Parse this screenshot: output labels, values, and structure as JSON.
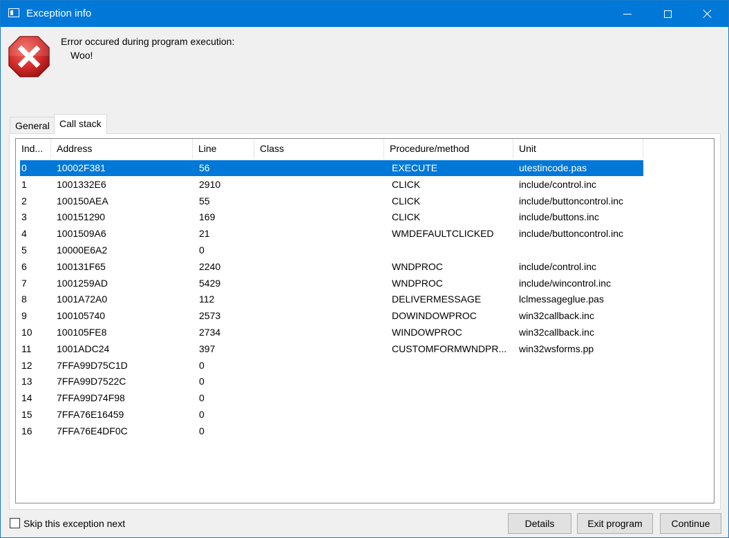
{
  "window": {
    "title": "Exception info"
  },
  "message": {
    "line1": "Error occured during program execution:",
    "line2": "Woo!"
  },
  "tabs": [
    {
      "label": "General",
      "active": false
    },
    {
      "label": "Call stack",
      "active": true
    }
  ],
  "columns": [
    "Ind...",
    "Address",
    "Line",
    "Class",
    "Procedure/method",
    "Unit"
  ],
  "rows": [
    {
      "index": "0",
      "address": "10002F381",
      "line": "56",
      "class": "",
      "procedure": "EXECUTE",
      "unit": "utestincode.pas",
      "selected": true
    },
    {
      "index": "1",
      "address": "1001332E6",
      "line": "2910",
      "class": "",
      "procedure": "CLICK",
      "unit": "include/control.inc"
    },
    {
      "index": "2",
      "address": "100150AEA",
      "line": "55",
      "class": "",
      "procedure": "CLICK",
      "unit": "include/buttoncontrol.inc"
    },
    {
      "index": "3",
      "address": "100151290",
      "line": "169",
      "class": "",
      "procedure": "CLICK",
      "unit": "include/buttons.inc"
    },
    {
      "index": "4",
      "address": "1001509A6",
      "line": "21",
      "class": "",
      "procedure": "WMDEFAULTCLICKED",
      "unit": "include/buttoncontrol.inc"
    },
    {
      "index": "5",
      "address": "10000E6A2",
      "line": "0",
      "class": "",
      "procedure": "",
      "unit": ""
    },
    {
      "index": "6",
      "address": "100131F65",
      "line": "2240",
      "class": "",
      "procedure": "WNDPROC",
      "unit": "include/control.inc"
    },
    {
      "index": "7",
      "address": "1001259AD",
      "line": "5429",
      "class": "",
      "procedure": "WNDPROC",
      "unit": "include/wincontrol.inc"
    },
    {
      "index": "8",
      "address": "1001A72A0",
      "line": "112",
      "class": "",
      "procedure": "DELIVERMESSAGE",
      "unit": "lclmessageglue.pas"
    },
    {
      "index": "9",
      "address": "100105740",
      "line": "2573",
      "class": "",
      "procedure": "DOWINDOWPROC",
      "unit": "win32callback.inc"
    },
    {
      "index": "10",
      "address": "100105FE8",
      "line": "2734",
      "class": "",
      "procedure": "WINDOWPROC",
      "unit": "win32callback.inc"
    },
    {
      "index": "11",
      "address": "1001ADC24",
      "line": "397",
      "class": "",
      "procedure": "CUSTOMFORMWNDPR...",
      "unit": "win32wsforms.pp"
    },
    {
      "index": "12",
      "address": "7FFA99D75C1D",
      "line": "0",
      "class": "",
      "procedure": "",
      "unit": ""
    },
    {
      "index": "13",
      "address": "7FFA99D7522C",
      "line": "0",
      "class": "",
      "procedure": "",
      "unit": ""
    },
    {
      "index": "14",
      "address": "7FFA99D74F98",
      "line": "0",
      "class": "",
      "procedure": "",
      "unit": ""
    },
    {
      "index": "15",
      "address": "7FFA76E16459",
      "line": "0",
      "class": "",
      "procedure": "",
      "unit": ""
    },
    {
      "index": "16",
      "address": "7FFA76E4DF0C",
      "line": "0",
      "class": "",
      "procedure": "",
      "unit": ""
    }
  ],
  "footer": {
    "skip_label": "Skip this exception next",
    "skip_checked": false,
    "details_label": "Details",
    "exit_label": "Exit program",
    "continue_label": "Continue"
  },
  "colors": {
    "titlebar": "#0078d7",
    "selection": "#0078d7",
    "error_icon": "#d42b2b"
  },
  "icons": {
    "app": "app-window-icon",
    "error": "error-x-icon"
  }
}
